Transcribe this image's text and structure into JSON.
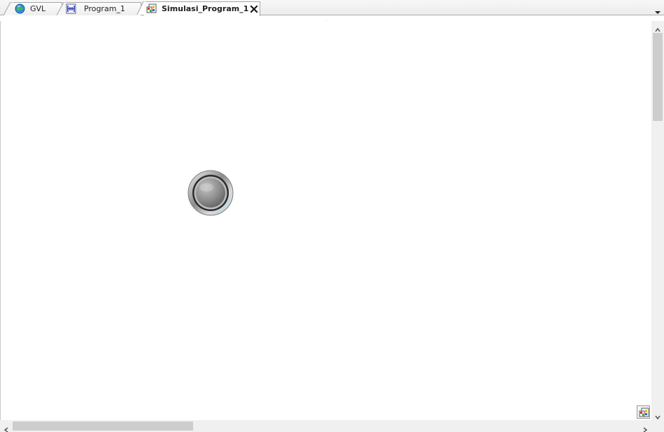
{
  "tabs": [
    {
      "label": "GVL",
      "icon": "global-variable-list-icon",
      "active": false
    },
    {
      "label": "Program_1",
      "icon": "ladder-program-icon",
      "active": false
    },
    {
      "label": "Simulasi_Program_1",
      "icon": "visualization-icon",
      "active": true
    }
  ],
  "icons": {
    "close": "close-icon",
    "overflow": "chevron-down-icon",
    "splitter_up": "triangle-up-icon",
    "splitter_down": "triangle-down-icon",
    "scroll_up": "chevron-up-icon",
    "scroll_down": "chevron-down-icon",
    "scroll_left": "chevron-left-icon",
    "scroll_right": "chevron-right-icon",
    "visu_corner": "visualization-icon"
  },
  "canvas": {
    "widget": "lamp-button",
    "background": "#ffffff"
  },
  "colors": {
    "tab_border": "#a6a6a6",
    "scrollbar_track": "#f0f0f0",
    "scrollbar_thumb": "#cdcdcd"
  }
}
